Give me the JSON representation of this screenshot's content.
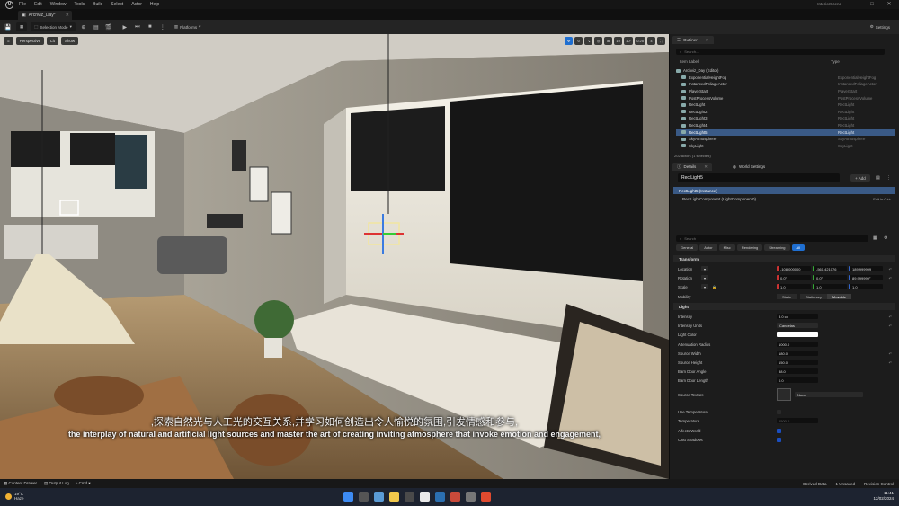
{
  "menubar": {
    "logo": "U",
    "items": [
      "File",
      "Edit",
      "Window",
      "Tools",
      "Build",
      "Select",
      "Actor",
      "Help"
    ],
    "project": "InteriorScene"
  },
  "tabs": {
    "level": "Archviz_Day*"
  },
  "toolbar": {
    "save_icon": "save-icon",
    "selection_mode": "Selection Mode",
    "platforms": "Platforms",
    "settings": "Settings"
  },
  "viewport": {
    "view": "Perspective",
    "lit": "Lit",
    "show": "Show",
    "right_controls": [
      "10",
      "10°",
      "0.25",
      "4"
    ],
    "subtitle_cn": ",探索自然光与人工光的交互关系,并学习如何创造出令人愉悦的氛围,引发情感和参与,",
    "subtitle_en": "the interplay of natural and artificial light sources and master the art of creating inviting atmosphere that invoke emotion and engagement,"
  },
  "outliner": {
    "tab": "Outliner",
    "search_placeholder": "Search...",
    "col_label": "Item Label",
    "col_type": "Type",
    "rows": [
      {
        "label": "Archviz_Day (Editor)",
        "type": ""
      },
      {
        "label": "ExponentialHeightFog",
        "type": "ExponentialHeightFog"
      },
      {
        "label": "InstancedFoliageActor",
        "type": "InstancedFoliageActor"
      },
      {
        "label": "PlayerStart",
        "type": "PlayerStart"
      },
      {
        "label": "PostProcessVolume",
        "type": "PostProcessVolume"
      },
      {
        "label": "RectLight",
        "type": "RectLight"
      },
      {
        "label": "RectLight2",
        "type": "RectLight"
      },
      {
        "label": "RectLight3",
        "type": "RectLight"
      },
      {
        "label": "RectLight4",
        "type": "RectLight"
      },
      {
        "label": "RectLight5",
        "type": "RectLight"
      },
      {
        "label": "SkyAtmosphere",
        "type": "SkyAtmosphere"
      },
      {
        "label": "SkyLight",
        "type": "SkyLight"
      }
    ],
    "selected_index": 9,
    "count": "202 actors (1 selected)"
  },
  "details": {
    "tab": "Details",
    "tab2": "World Settings",
    "name": "RectLight5",
    "add": "+ Add",
    "instance_row": "RectLight5 (Instance)",
    "component_row": "RectLightComponent (LightComponent0)",
    "edit_cpp": "Edit in C++",
    "search_placeholder": "Search",
    "categories": [
      "General",
      "Actor",
      "Misc",
      "Rendering",
      "Streaming",
      "All"
    ],
    "active_category": "All",
    "transform_header": "Transform",
    "location_label": "Location",
    "location": [
      "-108.000000",
      "-561.421076",
      "189.999999"
    ],
    "rotation_label": "Rotation",
    "rotation": [
      "0.0°",
      "0.0°",
      "89.999999°"
    ],
    "scale_label": "Scale",
    "scale": [
      "1.0",
      "1.0",
      "1.0"
    ],
    "mobility_label": "Mobility",
    "mobility": [
      "Static",
      "Stationary",
      "Movable"
    ],
    "light_header": "Light",
    "props": [
      {
        "label": "Intensity",
        "value": "8.0 cd"
      },
      {
        "label": "Intensity Units",
        "value": "Candelas"
      },
      {
        "label": "Light Color",
        "value": ""
      },
      {
        "label": "Attenuation Radius",
        "value": "1000.0"
      },
      {
        "label": "Source Width",
        "value": "180.0"
      },
      {
        "label": "Source Height",
        "value": "150.0"
      },
      {
        "label": "Barn Door Angle",
        "value": "88.0"
      },
      {
        "label": "Barn Door Length",
        "value": "0.0"
      },
      {
        "label": "Source Texture",
        "value": "None"
      },
      {
        "label": "Use Temperature",
        "value": ""
      },
      {
        "label": "Temperature",
        "value": "6500.0"
      },
      {
        "label": "Affects World",
        "value": ""
      },
      {
        "label": "Cast Shadows",
        "value": ""
      }
    ]
  },
  "statusbar": {
    "content_drawer": "Content Drawer",
    "output_log": "Output Log",
    "cmd": "Cmd",
    "derived_data": "Derived Data",
    "unsaved": "1 Unsaved",
    "revision": "Revision Control"
  },
  "taskbar": {
    "temp": "19°C",
    "weather": "Haze",
    "time": "11:41",
    "date": "12/02/2024"
  },
  "colors": {
    "accent": "#1f6fd1",
    "selection": "#3a5a86"
  }
}
